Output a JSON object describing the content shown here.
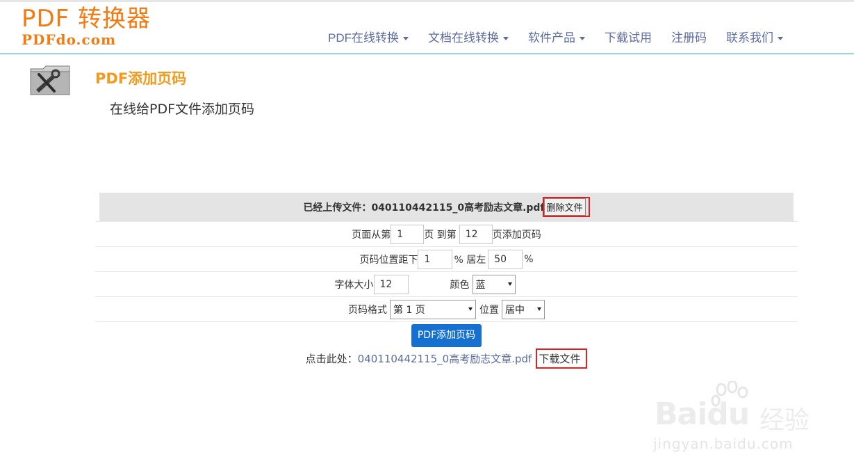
{
  "logo": {
    "title": "PDF 转换器",
    "domain": "PDFdo.com"
  },
  "nav": [
    {
      "label": "PDF在线转换",
      "dropdown": true
    },
    {
      "label": "文档在线转换",
      "dropdown": true
    },
    {
      "label": "软件产品",
      "dropdown": true
    },
    {
      "label": "下载试用",
      "dropdown": false
    },
    {
      "label": "注册码",
      "dropdown": false
    },
    {
      "label": "联系我们",
      "dropdown": true
    }
  ],
  "page": {
    "title": "PDF添加页码",
    "subtitle": "在线给PDF文件添加页码"
  },
  "upload": {
    "label": "已经上传文件：",
    "filename": "040110442115_0高考励志文章.pdf",
    "delete_label": "删除文件"
  },
  "form": {
    "range": {
      "prefix": "页面从第",
      "from": "1",
      "mid": "页 到第",
      "to": "12",
      "suffix": "页添加页码"
    },
    "position": {
      "prefix": "页码位置距下",
      "bottom": "1",
      "mid": "% 居左",
      "left": "50",
      "suffix": "%"
    },
    "font": {
      "prefix": "字体大小",
      "size": "12",
      "color_label": "颜色",
      "color_value": "蓝"
    },
    "format": {
      "prefix": "页码格式",
      "value": "第 1 页",
      "pos_label": "位置",
      "pos_value": "居中"
    },
    "submit_label": "PDF添加页码"
  },
  "download": {
    "prefix": "点击此处：",
    "filename": "040110442115_0高考励志文章.pdf",
    "label": "下载文件"
  },
  "watermark": {
    "brand": "Baidu",
    "brand_cn": "经验",
    "url": "jingyan.baidu.com"
  },
  "colors": {
    "accent": "#f27b14",
    "title": "#f39a1e",
    "nav": "#5c6ba0",
    "button": "#1670cf",
    "highlight": "#e02020"
  }
}
